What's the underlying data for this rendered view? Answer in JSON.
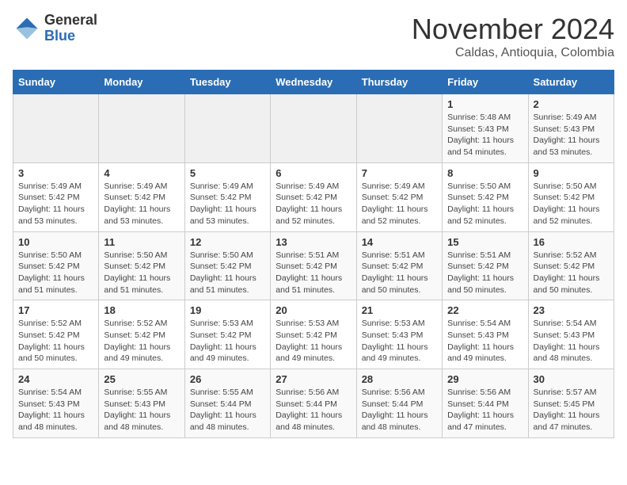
{
  "header": {
    "logo_line1": "General",
    "logo_line2": "Blue",
    "month_year": "November 2024",
    "location": "Caldas, Antioquia, Colombia"
  },
  "weekdays": [
    "Sunday",
    "Monday",
    "Tuesday",
    "Wednesday",
    "Thursday",
    "Friday",
    "Saturday"
  ],
  "weeks": [
    [
      {
        "day": "",
        "info": ""
      },
      {
        "day": "",
        "info": ""
      },
      {
        "day": "",
        "info": ""
      },
      {
        "day": "",
        "info": ""
      },
      {
        "day": "",
        "info": ""
      },
      {
        "day": "1",
        "info": "Sunrise: 5:48 AM\nSunset: 5:43 PM\nDaylight: 11 hours\nand 54 minutes."
      },
      {
        "day": "2",
        "info": "Sunrise: 5:49 AM\nSunset: 5:43 PM\nDaylight: 11 hours\nand 53 minutes."
      }
    ],
    [
      {
        "day": "3",
        "info": "Sunrise: 5:49 AM\nSunset: 5:42 PM\nDaylight: 11 hours\nand 53 minutes."
      },
      {
        "day": "4",
        "info": "Sunrise: 5:49 AM\nSunset: 5:42 PM\nDaylight: 11 hours\nand 53 minutes."
      },
      {
        "day": "5",
        "info": "Sunrise: 5:49 AM\nSunset: 5:42 PM\nDaylight: 11 hours\nand 53 minutes."
      },
      {
        "day": "6",
        "info": "Sunrise: 5:49 AM\nSunset: 5:42 PM\nDaylight: 11 hours\nand 52 minutes."
      },
      {
        "day": "7",
        "info": "Sunrise: 5:49 AM\nSunset: 5:42 PM\nDaylight: 11 hours\nand 52 minutes."
      },
      {
        "day": "8",
        "info": "Sunrise: 5:50 AM\nSunset: 5:42 PM\nDaylight: 11 hours\nand 52 minutes."
      },
      {
        "day": "9",
        "info": "Sunrise: 5:50 AM\nSunset: 5:42 PM\nDaylight: 11 hours\nand 52 minutes."
      }
    ],
    [
      {
        "day": "10",
        "info": "Sunrise: 5:50 AM\nSunset: 5:42 PM\nDaylight: 11 hours\nand 51 minutes."
      },
      {
        "day": "11",
        "info": "Sunrise: 5:50 AM\nSunset: 5:42 PM\nDaylight: 11 hours\nand 51 minutes."
      },
      {
        "day": "12",
        "info": "Sunrise: 5:50 AM\nSunset: 5:42 PM\nDaylight: 11 hours\nand 51 minutes."
      },
      {
        "day": "13",
        "info": "Sunrise: 5:51 AM\nSunset: 5:42 PM\nDaylight: 11 hours\nand 51 minutes."
      },
      {
        "day": "14",
        "info": "Sunrise: 5:51 AM\nSunset: 5:42 PM\nDaylight: 11 hours\nand 50 minutes."
      },
      {
        "day": "15",
        "info": "Sunrise: 5:51 AM\nSunset: 5:42 PM\nDaylight: 11 hours\nand 50 minutes."
      },
      {
        "day": "16",
        "info": "Sunrise: 5:52 AM\nSunset: 5:42 PM\nDaylight: 11 hours\nand 50 minutes."
      }
    ],
    [
      {
        "day": "17",
        "info": "Sunrise: 5:52 AM\nSunset: 5:42 PM\nDaylight: 11 hours\nand 50 minutes."
      },
      {
        "day": "18",
        "info": "Sunrise: 5:52 AM\nSunset: 5:42 PM\nDaylight: 11 hours\nand 49 minutes."
      },
      {
        "day": "19",
        "info": "Sunrise: 5:53 AM\nSunset: 5:42 PM\nDaylight: 11 hours\nand 49 minutes."
      },
      {
        "day": "20",
        "info": "Sunrise: 5:53 AM\nSunset: 5:42 PM\nDaylight: 11 hours\nand 49 minutes."
      },
      {
        "day": "21",
        "info": "Sunrise: 5:53 AM\nSunset: 5:43 PM\nDaylight: 11 hours\nand 49 minutes."
      },
      {
        "day": "22",
        "info": "Sunrise: 5:54 AM\nSunset: 5:43 PM\nDaylight: 11 hours\nand 49 minutes."
      },
      {
        "day": "23",
        "info": "Sunrise: 5:54 AM\nSunset: 5:43 PM\nDaylight: 11 hours\nand 48 minutes."
      }
    ],
    [
      {
        "day": "24",
        "info": "Sunrise: 5:54 AM\nSunset: 5:43 PM\nDaylight: 11 hours\nand 48 minutes."
      },
      {
        "day": "25",
        "info": "Sunrise: 5:55 AM\nSunset: 5:43 PM\nDaylight: 11 hours\nand 48 minutes."
      },
      {
        "day": "26",
        "info": "Sunrise: 5:55 AM\nSunset: 5:44 PM\nDaylight: 11 hours\nand 48 minutes."
      },
      {
        "day": "27",
        "info": "Sunrise: 5:56 AM\nSunset: 5:44 PM\nDaylight: 11 hours\nand 48 minutes."
      },
      {
        "day": "28",
        "info": "Sunrise: 5:56 AM\nSunset: 5:44 PM\nDaylight: 11 hours\nand 48 minutes."
      },
      {
        "day": "29",
        "info": "Sunrise: 5:56 AM\nSunset: 5:44 PM\nDaylight: 11 hours\nand 47 minutes."
      },
      {
        "day": "30",
        "info": "Sunrise: 5:57 AM\nSunset: 5:45 PM\nDaylight: 11 hours\nand 47 minutes."
      }
    ]
  ]
}
